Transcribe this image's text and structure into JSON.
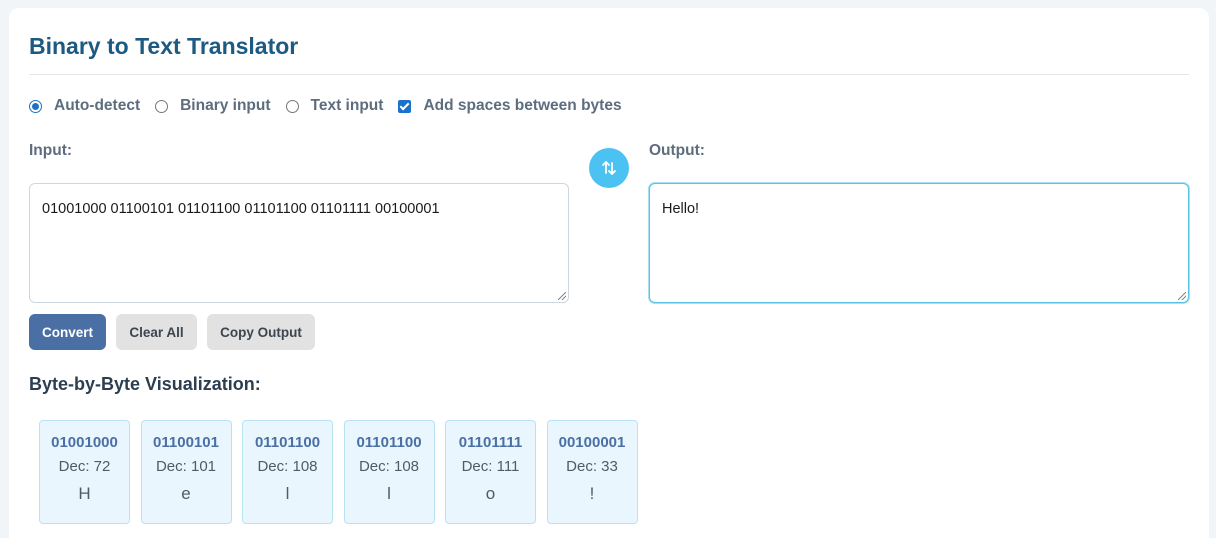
{
  "title": "Binary to Text Translator",
  "options": [
    {
      "label": "Auto-detect",
      "type": "radio",
      "checked": true
    },
    {
      "label": "Binary input",
      "type": "radio",
      "checked": false
    },
    {
      "label": "Text input",
      "type": "radio",
      "checked": false
    },
    {
      "label": "Add spaces between bytes",
      "type": "checkbox",
      "checked": true
    }
  ],
  "input": {
    "label": "Input:",
    "value": "01001000 01100101 01101100 01101100 01101111 00100001"
  },
  "output": {
    "label": "Output:",
    "value": "Hello!"
  },
  "swap_icon": "swap-vertical-arrows-icon",
  "buttons": {
    "convert": "Convert",
    "clear": "Clear All",
    "copy": "Copy Output"
  },
  "visualization": {
    "title": "Byte-by-Byte Visualization:",
    "bytes": [
      {
        "binary": "01001000",
        "decimal": "Dec: 72",
        "char": "H"
      },
      {
        "binary": "01100101",
        "decimal": "Dec: 101",
        "char": "e"
      },
      {
        "binary": "01101100",
        "decimal": "Dec: 108",
        "char": "l"
      },
      {
        "binary": "01101100",
        "decimal": "Dec: 108",
        "char": "l"
      },
      {
        "binary": "01101111",
        "decimal": "Dec: 111",
        "char": "o"
      },
      {
        "binary": "00100001",
        "decimal": "Dec: 33",
        "char": "!"
      }
    ]
  },
  "colors": {
    "title": "#1d5a82",
    "accent": "#4a6fa5",
    "swap_button": "#4cc2f2",
    "byte_card_bg": "#eaf6fd"
  }
}
